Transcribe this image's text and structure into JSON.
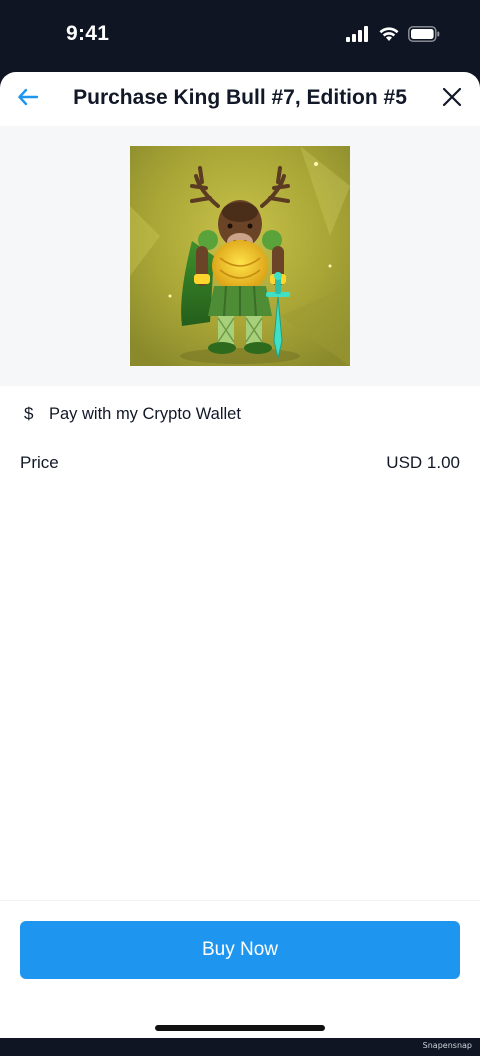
{
  "status_bar": {
    "time": "9:41",
    "icons": [
      "signal-icon",
      "wifi-icon",
      "battery-icon"
    ]
  },
  "header": {
    "title": "Purchase King Bull #7, Edition #5",
    "back_icon": "arrow-left-icon",
    "close_icon": "close-icon",
    "accent_color": "#1e96f0"
  },
  "nft": {
    "image_description_icon": "nft-artwork-icon"
  },
  "payment": {
    "icon": "dollar-icon",
    "label": "Pay with my Crypto Wallet"
  },
  "price": {
    "label": "Price",
    "value": "USD 1.00"
  },
  "footer": {
    "buy_label": "Buy Now",
    "button_color": "#1e96f0"
  },
  "watermark": "Snapensnap"
}
